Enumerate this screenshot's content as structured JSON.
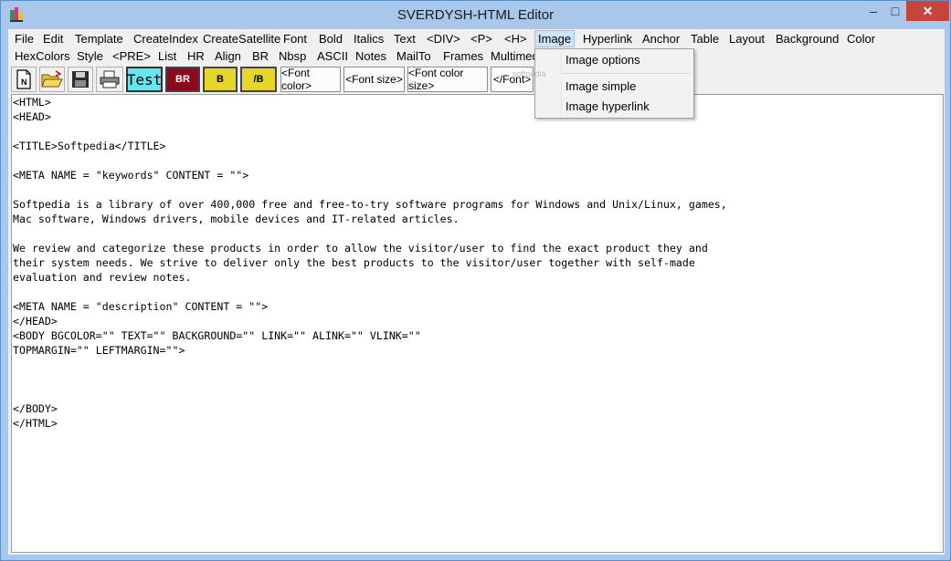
{
  "window": {
    "title": "SVERDYSH-HTML Editor",
    "minimize": "–",
    "maximize": "□",
    "close": "✕"
  },
  "menu_row1": [
    "File",
    "Edit",
    "Template",
    "CreateIndex",
    "CreateSatellite",
    "Font",
    "Bold",
    "Italics",
    "Text",
    "<DIV>",
    "<P>",
    "<H>",
    "Image",
    "Hyperlink",
    "Anchor",
    "Table",
    "Layout",
    "Background",
    "Color"
  ],
  "menu_row2": [
    "HexColors",
    "Style",
    "<PRE>",
    "List",
    "HR",
    "Align",
    "BR",
    "Nbsp",
    "ASCII",
    "Notes",
    "MailTo",
    "Frames",
    "Multimedia"
  ],
  "toolbar": {
    "test": "Test",
    "br": "BR",
    "b": "B",
    "close_b": "/B",
    "font_color": "<Font color>",
    "font_size": "<Font size>",
    "font_color_size": "<Font color size>",
    "close_font": "</Font>"
  },
  "image_menu": {
    "options": "Image options",
    "simple": "Image simple",
    "hyperlink": "Image hyperlink"
  },
  "watermark": "softpedia",
  "editor": {
    "content": "<HTML>\n<HEAD>\n\n<TITLE>Softpedia</TITLE>\n\n<META NAME = \"keywords\" CONTENT = \"\">\n\nSoftpedia is a library of over 400,000 free and free-to-try software programs for Windows and Unix/Linux, games,\nMac software, Windows drivers, mobile devices and IT-related articles.\n\nWe review and categorize these products in order to allow the visitor/user to find the exact product they and\ntheir system needs. We strive to deliver only the best products to the visitor/user together with self-made\nevaluation and review notes.\n\n<META NAME = \"description\" CONTENT = \"\">\n</HEAD>\n<BODY BGCOLOR=\"\" TEXT=\"\" BACKGROUND=\"\" LINK=\"\" ALINK=\"\" VLINK=\"\"\nTOPMARGIN=\"\" LEFTMARGIN=\"\">\n\n\n\n</BODY>\n</HTML>"
  },
  "colors": {
    "window_frame": "#a9c7ea",
    "close_button": "#c7443a",
    "test_button": "#66e6ee",
    "br_button": "#8b0a1f",
    "b_button": "#e6d629"
  }
}
